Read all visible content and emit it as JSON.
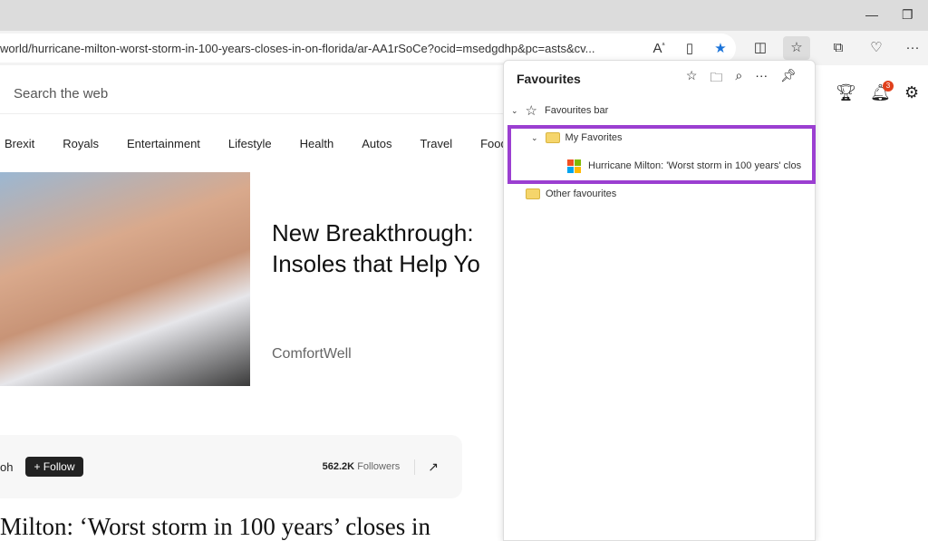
{
  "browser": {
    "url": "world/hurricane-milton-worst-storm-in-100-years-closes-in-on-florida/ar-AA1rSoCe?ocid=msedgdhp&pc=asts&cv...",
    "icons": [
      "read-aloud-icon",
      "immersive-reader-icon",
      "favorite-star-icon",
      "split-screen-icon",
      "favorites-icon",
      "collections-icon",
      "browser-essentials-icon",
      "more-icon"
    ],
    "accent": "#1a73d9"
  },
  "page": {
    "search_placeholder": "Search the web",
    "nav": [
      "Brexit",
      "Royals",
      "Entertainment",
      "Lifestyle",
      "Health",
      "Autos",
      "Travel",
      "Food"
    ],
    "ad_headline_1": "New Breakthrough:",
    "ad_headline_2": "Insoles that Help Yo",
    "ad_brand": "ComfortWell",
    "publisher_suffix": "oh",
    "follow_label": "+ Follow",
    "followers_count": "562.2K",
    "followers_label": "Followers",
    "article_title": "Milton: ‘Worst storm in 100 years’ closes in",
    "notification_count": "3"
  },
  "favourites": {
    "title": "Favourites",
    "bar_label": "Favourites bar",
    "folder": "My Favorites",
    "item": "Hurricane Milton: 'Worst storm in 100 years' clos",
    "other": "Other favourites",
    "highlight_color": "#9b3fd1"
  }
}
